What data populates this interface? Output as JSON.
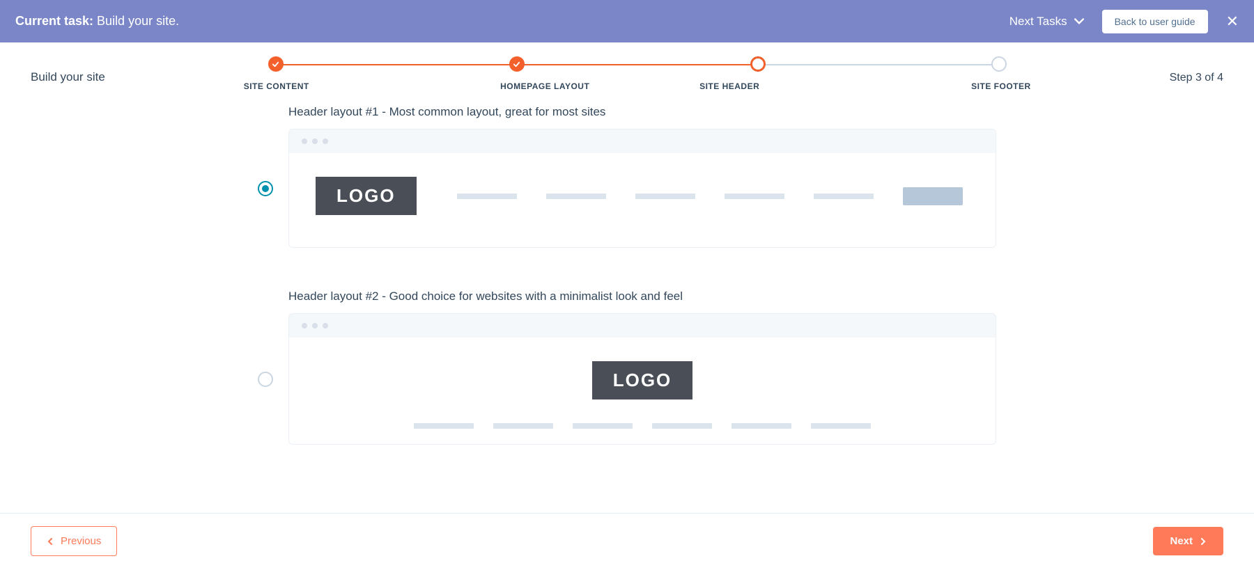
{
  "banner": {
    "task_prefix": "Current task:",
    "task_name": "Build your site.",
    "next_tasks_label": "Next Tasks",
    "back_button": "Back to user guide"
  },
  "stepper": {
    "left_label": "Build your site",
    "right_label": "Step 3 of 4",
    "steps": [
      {
        "id": "site-content",
        "label": "SITE CONTENT",
        "state": "done"
      },
      {
        "id": "homepage-layout",
        "label": "HOMEPAGE LAYOUT",
        "state": "done"
      },
      {
        "id": "site-header",
        "label": "SITE HEADER",
        "state": "current"
      },
      {
        "id": "site-footer",
        "label": "SITE FOOTER",
        "state": "pending"
      }
    ]
  },
  "options": [
    {
      "id": "header-layout-1",
      "description": "Header layout #1 - Most common layout, great for most sites",
      "selected": true,
      "logo_text": "LOGO"
    },
    {
      "id": "header-layout-2",
      "description": "Header layout #2 - Good choice for websites with a minimalist look and feel",
      "selected": false,
      "logo_text": "LOGO"
    }
  ],
  "footer": {
    "previous": "Previous",
    "next": "Next"
  },
  "icons": {
    "check": "check-icon",
    "chevron_down": "chevron-down-icon",
    "chevron_left": "chevron-left-icon",
    "chevron_right": "chevron-right-icon",
    "close": "close-icon"
  }
}
